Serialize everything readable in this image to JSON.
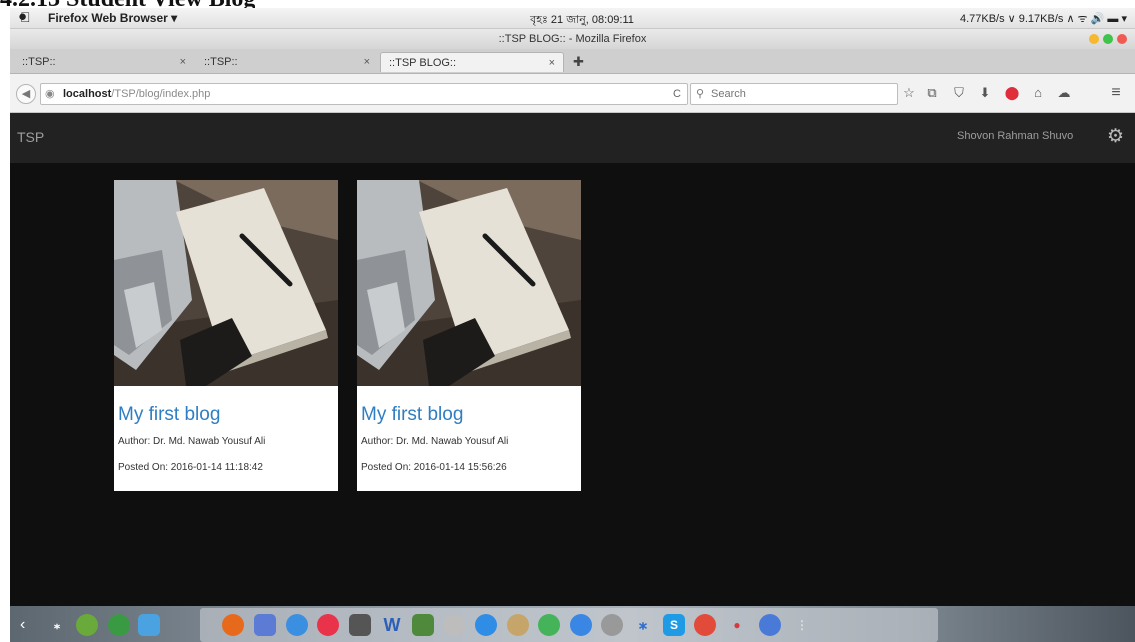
{
  "doc_heading": "4.2.13 Student View Blog",
  "menubar": {
    "apple_icon": "apple-logo",
    "app_name": "Firefox Web Browser ▾",
    "clock": "বৃহঃ 21 জানু, 08:09:11",
    "network": "4.77KB/s ∨ 9.17KB/s ∧  ᯤ  🔊  ▬ ▾"
  },
  "window": {
    "title": "::TSP BLOG:: - Mozilla Firefox"
  },
  "tabs": [
    {
      "label": "::TSP::",
      "close": "×"
    },
    {
      "label": "::TSP::",
      "close": "×"
    },
    {
      "label": "::TSP BLOG::",
      "close": "×"
    }
  ],
  "new_tab_icon": "✚",
  "address": {
    "host": "localhost",
    "path": "/TSP/blog/index.php",
    "reload_icon": "C"
  },
  "search": {
    "placeholder": "Search",
    "icon": "⚲"
  },
  "toolbar_icons": [
    "☆",
    "⧉",
    "⛉",
    "⬇",
    "⬤",
    "⌂",
    "☁",
    "≡"
  ],
  "site": {
    "brand": "TSP",
    "user_name": "Shovon Rahman Shuvo",
    "settings_icon": "gear-icon",
    "posts": [
      {
        "title": "My first blog",
        "author": "Author: Dr. Md. Nawab Yousuf Ali",
        "posted": "Posted On: 2016-01-14 11:18:42"
      },
      {
        "title": "My first blog",
        "author": "Author: Dr. Md. Nawab Yousuf Ali",
        "posted": "Posted On: 2016-01-14 15:56:26"
      }
    ]
  },
  "colors": {
    "link": "#2f7ec3",
    "navbar": "#222222",
    "page_bg": "#0f0f0f"
  },
  "dock": {
    "left_arrow": "‹",
    "right_arrow": "›"
  }
}
